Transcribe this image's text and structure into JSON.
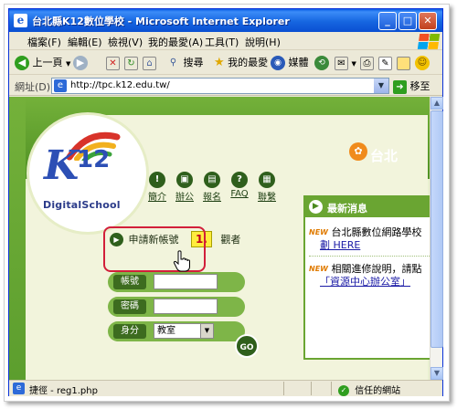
{
  "window": {
    "title": "台北縣K12數位學校 - Microsoft Internet Explorer",
    "minimize_glyph": "_",
    "maximize_glyph": "□",
    "close_glyph": "✕"
  },
  "menu": {
    "items": [
      "檔案(F)",
      "編輯(E)",
      "檢視(V)",
      "我的最愛(A)",
      "工具(T)",
      "說明(H)"
    ]
  },
  "toolbar": {
    "back_label": "上一頁",
    "search_label": "搜尋",
    "favorites_label": "我的最愛",
    "media_label": "媒體"
  },
  "address": {
    "label": "網址(D)",
    "url": "http://tpc.k12.edu.tw/",
    "go_label": "移至"
  },
  "site": {
    "logo_letter": "K",
    "logo_number": "12",
    "logo_subtitle": "DigitalSchool",
    "brand_text": "台北",
    "nav": [
      {
        "label": "簡介",
        "icon": "info-icon"
      },
      {
        "label": "辦公",
        "icon": "lock-icon"
      },
      {
        "label": "報名",
        "icon": "register-icon"
      },
      {
        "label": "FAQ",
        "icon": "question-icon"
      },
      {
        "label": "聯繫",
        "icon": "contact-icon"
      }
    ],
    "news": {
      "title": "最新消息",
      "new_tag": "NEW",
      "item1_text": "台北縣數位網路學校",
      "item1_link": "劃 HERE",
      "item2_text": "相關進修說明，請點",
      "item2_link": "「資源中心辦公室」"
    },
    "login": {
      "apply_label": "申請新帳號",
      "step_badge": "1.",
      "guest_label": "觀者",
      "account_label": "帳號",
      "account_value": "",
      "password_label": "密碼",
      "password_value": "",
      "identity_label": "身分",
      "identity_value": "教室",
      "go_label": "GO"
    }
  },
  "status": {
    "text": "捷徑 - reg1.php",
    "zone": "信任的網站"
  },
  "colors": {
    "title_blue": "#0a5de6",
    "site_green": "#6aa532",
    "highlight_red": "#d21f3a",
    "badge_yellow": "#ffec3d"
  }
}
